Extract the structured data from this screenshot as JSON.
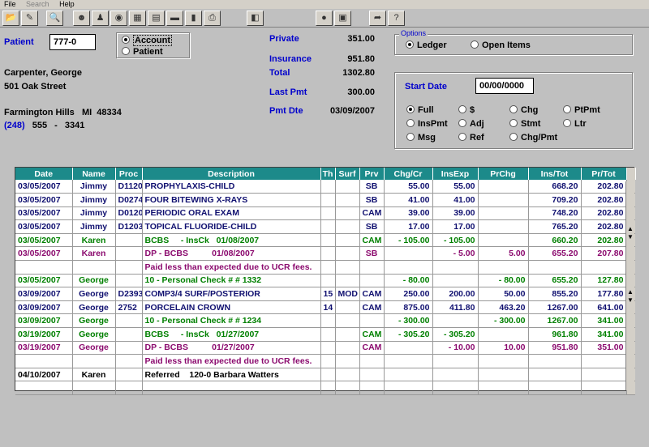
{
  "menu": {
    "file": "File",
    "search": "Search",
    "help": "Help"
  },
  "toolbar": {
    "icons": [
      "open-icon",
      "save-icon",
      "find-icon",
      "patient-icon",
      "family-icon",
      "appointment-icon",
      "chart-icon",
      "ledger-icon",
      "insurance-icon",
      "payment-icon",
      "print-icon",
      "module-icon",
      "record-icon",
      "calendar-icon",
      "exit-icon",
      "help-icon"
    ]
  },
  "patient": {
    "label": "Patient",
    "id": "777-0",
    "name": "Carpenter, George",
    "street": "501 Oak Street",
    "city_state_zip": "Farmington Hills   MI  48334",
    "area_code": "(248)",
    "phone_mid": "555",
    "phone_dash": "-",
    "phone_last": "3341"
  },
  "view": {
    "account": "Account",
    "patient": "Patient",
    "selected": "account"
  },
  "balances": {
    "private_label": "Private",
    "private": "351.00",
    "insurance_label": "Insurance",
    "insurance": "951.80",
    "total_label": "Total",
    "total": "1302.80",
    "last_pmt_label": "Last Pmt",
    "last_pmt": "300.00",
    "pmt_dte_label": "Pmt Dte",
    "pmt_dte": "03/09/2007"
  },
  "options": {
    "legend": "Options",
    "ledger": "Ledger",
    "open_items": "Open Items",
    "selected": "ledger"
  },
  "filter": {
    "start_date_label": "Start Date",
    "start_date": "00/00/0000",
    "opts": {
      "full": "Full",
      "dollar": "$",
      "chg": "Chg",
      "ptpmt": "PtPmt",
      "inspmt": "InsPmt",
      "adj": "Adj",
      "stmt": "Stmt",
      "ltr": "Ltr",
      "msg": "Msg",
      "ref": "Ref",
      "chgpmt": "Chg/Pmt"
    },
    "selected": "full"
  },
  "ledger": {
    "headers": [
      "Date",
      "Name",
      "Proc",
      "Description",
      "Th",
      "Surf",
      "Prv",
      "Chg/Cr",
      "InsExp",
      "PrChg",
      "Ins/Tot",
      "Pr/Tot"
    ],
    "rows": [
      {
        "c": "navy",
        "cells": [
          "03/05/2007",
          "Jimmy",
          "D1120",
          "PROPHYLAXIS-CHILD",
          "",
          "",
          "SB",
          "55.00",
          "55.00",
          "",
          "668.20",
          "202.80"
        ]
      },
      {
        "c": "navy",
        "cells": [
          "03/05/2007",
          "Jimmy",
          "D0274",
          "FOUR BITEWING X-RAYS",
          "",
          "",
          "SB",
          "41.00",
          "41.00",
          "",
          "709.20",
          "202.80"
        ]
      },
      {
        "c": "navy",
        "cells": [
          "03/05/2007",
          "Jimmy",
          "D0120",
          "PERIODIC ORAL EXAM",
          "",
          "",
          "CAM",
          "39.00",
          "39.00",
          "",
          "748.20",
          "202.80"
        ]
      },
      {
        "c": "navy",
        "cells": [
          "03/05/2007",
          "Jimmy",
          "D1203",
          "TOPICAL FLUORIDE-CHILD",
          "",
          "",
          "SB",
          "17.00",
          "17.00",
          "",
          "765.20",
          "202.80"
        ]
      },
      {
        "c": "green",
        "cells": [
          "03/05/2007",
          "Karen",
          "",
          "BCBS     - InsCk   01/08/2007",
          "",
          "",
          "CAM",
          "- 105.00",
          "- 105.00",
          "",
          "660.20",
          "202.80"
        ]
      },
      {
        "c": "purple",
        "cells": [
          "03/05/2007",
          "Karen",
          "",
          "DP - BCBS          01/08/2007",
          "",
          "",
          "SB",
          "",
          "- 5.00",
          "5.00",
          "655.20",
          "207.80"
        ]
      },
      {
        "c": "purple",
        "cells": [
          "",
          "",
          "",
          "Paid less than expected due to UCR fees.",
          "",
          "",
          "",
          "",
          "",
          "",
          "",
          ""
        ]
      },
      {
        "c": "green",
        "cells": [
          "03/05/2007",
          "George",
          "",
          "10 - Personal Check # # 1332",
          "",
          "",
          "",
          "- 80.00",
          "",
          "- 80.00",
          "655.20",
          "127.80"
        ]
      },
      {
        "c": "navy",
        "cells": [
          "03/09/2007",
          "George",
          "D2393",
          "COMP3/4 SURF/POSTERIOR",
          "15",
          "MOD",
          "CAM",
          "250.00",
          "200.00",
          "50.00",
          "855.20",
          "177.80"
        ]
      },
      {
        "c": "navy",
        "cells": [
          "03/09/2007",
          "George",
          "2752",
          "PORCELAIN CROWN",
          "14",
          "",
          "CAM",
          "875.00",
          "411.80",
          "463.20",
          "1267.00",
          "641.00"
        ]
      },
      {
        "c": "green",
        "cells": [
          "03/09/2007",
          "George",
          "",
          "10 - Personal Check # # 1234",
          "",
          "",
          "",
          "- 300.00",
          "",
          "- 300.00",
          "1267.00",
          "341.00"
        ]
      },
      {
        "c": "green",
        "cells": [
          "03/19/2007",
          "George",
          "",
          "BCBS     - InsCk   01/27/2007",
          "",
          "",
          "CAM",
          "- 305.20",
          "- 305.20",
          "",
          "961.80",
          "341.00"
        ]
      },
      {
        "c": "purple",
        "cells": [
          "03/19/2007",
          "George",
          "",
          "DP - BCBS          01/27/2007",
          "",
          "",
          "CAM",
          "",
          "- 10.00",
          "10.00",
          "951.80",
          "351.00"
        ]
      },
      {
        "c": "purple",
        "cells": [
          "",
          "",
          "",
          "Paid less than expected due to UCR fees.",
          "",
          "",
          "",
          "",
          "",
          "",
          "",
          ""
        ]
      },
      {
        "c": "black",
        "cells": [
          "04/10/2007",
          "Karen",
          "",
          "Referred    120-0 Barbara Watters",
          "",
          "",
          "",
          "",
          "",
          "",
          "",
          ""
        ]
      },
      {
        "c": "black",
        "cells": [
          "",
          "",
          "",
          "",
          "",
          "",
          "",
          "",
          "",
          "",
          "",
          ""
        ]
      }
    ]
  }
}
